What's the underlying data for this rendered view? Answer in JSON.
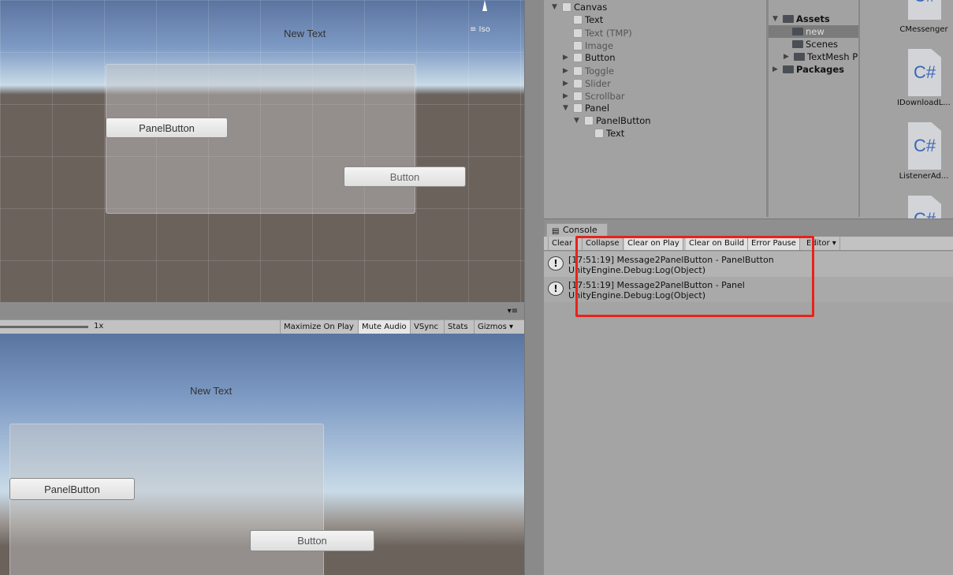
{
  "scene": {
    "new_text": "New Text",
    "panel_button": "PanelButton",
    "button": "Button",
    "iso": "≡ Iso"
  },
  "game_toolbar": {
    "scale": "1x",
    "maximize": "Maximize On Play",
    "mute": "Mute Audio",
    "vsync": "VSync",
    "stats": "Stats",
    "gizmos": "Gizmos",
    "menu": "▾≡"
  },
  "game": {
    "new_text": "New Text",
    "panel_button": "PanelButton",
    "button": "Button"
  },
  "hierarchy": {
    "items": [
      {
        "label": "Canvas",
        "expanded": true
      },
      {
        "label": "Text"
      },
      {
        "label": "Text (TMP)",
        "inactive": true
      },
      {
        "label": "Image",
        "inactive": true
      },
      {
        "label": "Button"
      },
      {
        "label": "Toggle",
        "inactive": true
      },
      {
        "label": "Slider",
        "inactive": true
      },
      {
        "label": "Scrollbar",
        "inactive": true
      },
      {
        "label": "Panel"
      },
      {
        "label": "PanelButton"
      },
      {
        "label": "Text"
      }
    ]
  },
  "project": {
    "folders": [
      "Assets",
      "new",
      "Scenes",
      "TextMesh P",
      "Packages"
    ],
    "selected": "new",
    "files": [
      {
        "icon": "C#",
        "name": "CMessenger"
      },
      {
        "icon": "C#",
        "name": "IDownloadL..."
      },
      {
        "icon": "C#",
        "name": "ListenerAd..."
      },
      {
        "icon": "C#",
        "name": ""
      }
    ]
  },
  "console": {
    "tab": "Console",
    "toolbar": [
      "Clear",
      "Collapse",
      "Clear on Play",
      "Clear on Build",
      "Error Pause",
      "Editor ▾"
    ],
    "entries": [
      {
        "line1": "[17:51:19] Message2PanelButton - PanelButton",
        "line2": "UnityEngine.Debug:Log(Object)"
      },
      {
        "line1": "[17:51:19] Message2PanelButton - Panel",
        "line2": "UnityEngine.Debug:Log(Object)"
      }
    ]
  },
  "colors": {
    "highlight": "#e8221a"
  }
}
